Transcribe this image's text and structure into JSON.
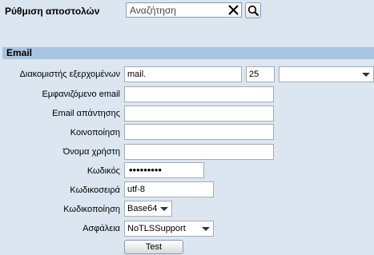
{
  "header": {
    "title": "Ρύθμιση αποστολών",
    "search_placeholder": "Αναζήτηση",
    "clear_icon": "close-icon",
    "search_icon": "search-icon"
  },
  "section": {
    "title": "Email"
  },
  "form": {
    "server": {
      "label": "Διακομιστής εξερχομένων",
      "value": "mail.",
      "port": "25",
      "mode": ""
    },
    "display_email": {
      "label": "Εμφανιζόμενο email",
      "value": ""
    },
    "reply_email": {
      "label": "Email απάντησης",
      "value": ""
    },
    "cc": {
      "label": "Κοινοποίηση",
      "value": ""
    },
    "username": {
      "label": "Όνομα χρήστη",
      "value": ""
    },
    "password": {
      "label": "Κωδικός",
      "value": "•••••••••"
    },
    "charset": {
      "label": "Κωδικοσειρά",
      "value": "utf-8"
    },
    "encoding": {
      "label": "Κωδικοποίηση",
      "value": "Base64"
    },
    "security": {
      "label": "Ασφάλεια",
      "value": "NoTLSSupport"
    }
  },
  "actions": {
    "test_label": "Test"
  }
}
